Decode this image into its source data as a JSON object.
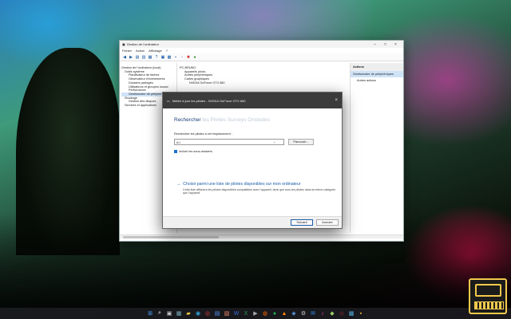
{
  "window": {
    "title": "Gestion de l'ordinateur",
    "menu": [
      "Fichier",
      "Action",
      "Affichage",
      "?"
    ]
  },
  "left_tree": [
    "Gestion de l'ordinateur (local)",
    "Outils système",
    "Planificateur de tâches",
    "Observateur d'événements",
    "Dossiers partagés",
    "Utilisateurs et groupes locaux",
    "Performance",
    "Gestionnaire de périphériques",
    "Stockage",
    "Gestion des disques",
    "Services et applications"
  ],
  "mid_tree": [
    "PC-BRUNO",
    "Appareils photo",
    "Autres périphériques",
    "Cartes graphiques",
    "NVIDIA GeForce GTX 660"
  ],
  "actions": {
    "header": "Actions",
    "selected": "Gestionnaire de périphériques",
    "item": "Autres actions"
  },
  "dialog": {
    "title": "Mettre à jour les pilotes - NVIDIA GeForce GTX 660",
    "heading": "Rechercher",
    "heading_faded": " les Pilotes Surveys Onstedes",
    "label": "Rechercher les pilotes à cet emplacement :",
    "input_value": "A:\\",
    "browse": "Parcourir...",
    "checkbox": "Inclure les sous-dossiers",
    "link": "Choisir parmi une liste de pilotes disponibles sur mon ordinateur",
    "description": "Cette liste affichera les pilotes disponibles compatibles avec l'appareil, ainsi que tous les pilotes dans la même catégorie que l'appareil.",
    "next": "Suivant",
    "cancel": "Annuler"
  },
  "colors": {
    "accent": "#1a5ca8",
    "dialog_bar": "#3b3b3b"
  },
  "taskbar_icons": [
    "windows-icon",
    "search-icon",
    "taskview-icon",
    "widgets-icon",
    "folder-icon",
    "edge-icon",
    "chrome-icon",
    "store-icon",
    "photos-icon",
    "word-icon",
    "excel-icon",
    "terminal-icon",
    "firefox-icon",
    "spotify-icon",
    "vlc-icon",
    "steam-icon",
    "settings-icon",
    "mail-icon",
    "music-icon",
    "game-icon",
    "shield-icon",
    "camera-icon",
    "app-icon"
  ]
}
